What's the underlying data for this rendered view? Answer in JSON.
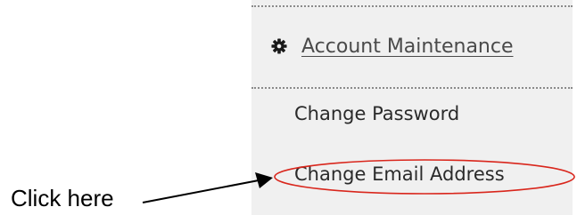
{
  "menu": {
    "section_header": {
      "label": "Account Maintenance",
      "icon": "gear-icon"
    },
    "items": [
      {
        "label": "Change Password"
      },
      {
        "label": "Change Email Address",
        "highlighted": true
      }
    ]
  },
  "annotation": {
    "callout_text": "Click here",
    "ellipse_color": "#d9261c",
    "arrow_color": "#000000"
  },
  "colors": {
    "panel_bg": "#f0f0f0",
    "divider": "#8a8a8a",
    "text": "#2a2a2a"
  }
}
